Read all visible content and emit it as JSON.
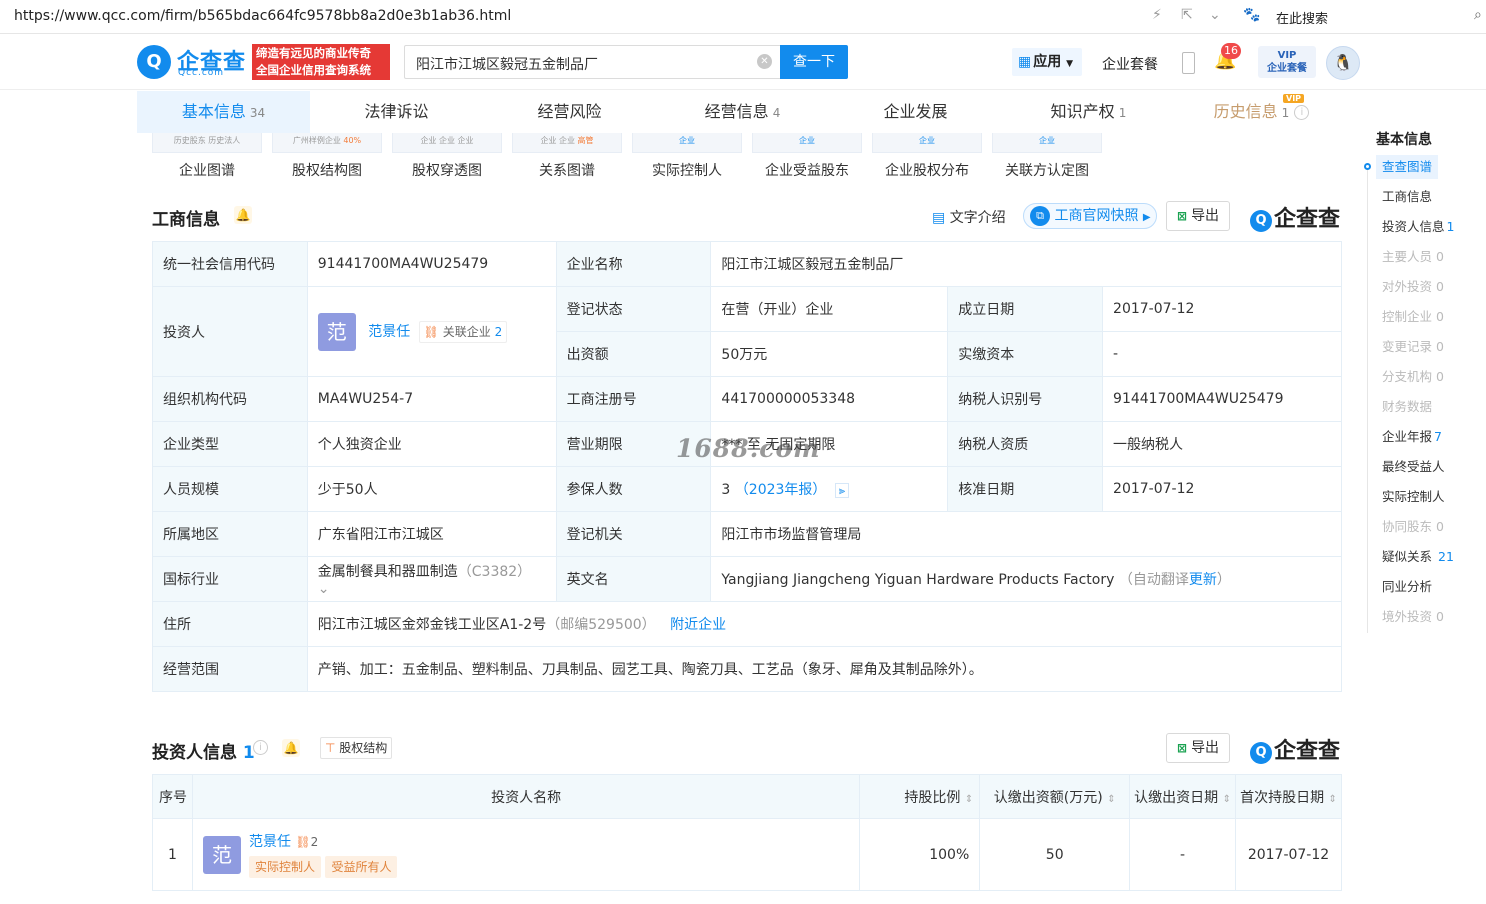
{
  "browser": {
    "url": "https://www.qcc.com/firm/b565bdac664fc9578bb8a2d0e3b1ab36.html",
    "search_placeholder": "在此搜索"
  },
  "header": {
    "logo_mark": "Q",
    "logo_text": "企查查",
    "logo_sub": "Qcc.com",
    "slogan_line1": "缔造有远见的商业传奇",
    "slogan_line2": "全国企业信用查询系统",
    "search_value": "阳江市江城区毅冠五金制品厂",
    "search_button": "查一下",
    "apps_label": "应用",
    "package_label": "企业套餐",
    "notification_count": "16",
    "vip_line1": "VIP",
    "vip_line2": "企业套餐"
  },
  "tabs": [
    {
      "label": "基本信息",
      "count": "34"
    },
    {
      "label": "法律诉讼",
      "count": ""
    },
    {
      "label": "经营风险",
      "count": ""
    },
    {
      "label": "经营信息",
      "count": "4"
    },
    {
      "label": "企业发展",
      "count": ""
    },
    {
      "label": "知识产权",
      "count": "1"
    },
    {
      "label": "历史信息",
      "count": "1",
      "badge": "VIP"
    }
  ],
  "graphs": [
    "企业图谱",
    "股权结构图",
    "股权穿透图",
    "关系图谱",
    "实际控制人",
    "企业受益股东",
    "企业股权分布",
    "关联方认定图"
  ],
  "thumb_texts": [
    "历史股东",
    "历史法人",
    "广州样例企业",
    "40%",
    "企业",
    "企业",
    "企业",
    "企业",
    "企业",
    "高管",
    "企业",
    "企业",
    "企业",
    "企业"
  ],
  "business": {
    "title": "工商信息",
    "text_intro": "文字介绍",
    "snapshot": "工商官网快照",
    "export": "导出",
    "brand": "企查查",
    "rows": {
      "credit_code_k": "统一社会信用代码",
      "credit_code_v": "91441700MA4WU25479",
      "name_k": "企业名称",
      "name_v": "阳江市江城区毅冠五金制品厂",
      "investor_k": "投资人",
      "investor_avatar": "范",
      "investor_v": "范景任",
      "related_k": "关联企业",
      "related_v": "2",
      "status_k": "登记状态",
      "status_v": "在营（开业）企业",
      "found_k": "成立日期",
      "found_v": "2017-07-12",
      "capital_k": "出资额",
      "capital_v": "50万元",
      "paid_k": "实缴资本",
      "paid_v": "-",
      "org_k": "组织机构代码",
      "org_v": "MA4WU254-7",
      "reg_k": "工商注册号",
      "reg_v": "441700000053348",
      "tax_k": "纳税人识别号",
      "tax_v": "91441700MA4WU25479",
      "type_k": "企业类型",
      "type_v": "个人独资企业",
      "term_k": "营业期限",
      "term_v": "*** 至 无固定期限",
      "taxq_k": "纳税人资质",
      "taxq_v": "一般纳税人",
      "size_k": "人员规模",
      "size_v": "少于50人",
      "ins_k": "参保人数",
      "ins_v": "3",
      "ins_year": "（2023年报）",
      "approve_k": "核准日期",
      "approve_v": "2017-07-12",
      "region_k": "所属地区",
      "region_v": "广东省阳江市江城区",
      "authority_k": "登记机关",
      "authority_v": "阳江市市场监督管理局",
      "industry_k": "国标行业",
      "industry_v": "金属制餐具和器皿制造",
      "industry_code": "（C3382）",
      "en_k": "英文名",
      "en_v": "Yangjiang Jiangcheng Yiguan Hardware Products Factory",
      "en_note_pre": "（自动翻译",
      "en_update": "更新",
      "en_note_post": "）",
      "addr_k": "住所",
      "addr_v": "阳江市江城区金郊金钱工业区A1-2号",
      "addr_zip": "（邮编529500）",
      "addr_near": "附近企业",
      "scope_k": "经营范围",
      "scope_v": "产销、加工：五金制品、塑料制品、刀具制品、园艺工具、陶瓷刀具、工艺品（象牙、犀角及其制品除外）。"
    }
  },
  "investors": {
    "title": "投资人信息",
    "count": "1",
    "equity_btn": "股权结构",
    "export": "导出",
    "brand": "企查查",
    "headers": [
      "序号",
      "投资人名称",
      "持股比例",
      "认缴出资额(万元)",
      "认缴出资日期",
      "首次持股日期"
    ],
    "rows": [
      {
        "idx": "1",
        "avatar": "范",
        "name": "范景任",
        "rel": "2",
        "tag1": "实际控制人",
        "tag2": "受益所有人",
        "ratio": "100%",
        "amount": "50",
        "date": "-",
        "first": "2017-07-12"
      }
    ]
  },
  "sidebar": {
    "title": "基本信息",
    "items": [
      {
        "label": "查查图谱",
        "count": ""
      },
      {
        "label": "工商信息",
        "count": ""
      },
      {
        "label": "投资人信息",
        "count": "1"
      },
      {
        "label": "主要人员",
        "count": "0"
      },
      {
        "label": "对外投资",
        "count": "0"
      },
      {
        "label": "控制企业",
        "count": "0"
      },
      {
        "label": "变更记录",
        "count": "0"
      },
      {
        "label": "分支机构",
        "count": "0"
      },
      {
        "label": "财务数据",
        "count": ""
      },
      {
        "label": "企业年报",
        "count": "7"
      },
      {
        "label": "最终受益人",
        "count": ""
      },
      {
        "label": "实际控制人",
        "count": ""
      },
      {
        "label": "协同股东",
        "count": "0"
      },
      {
        "label": "疑似关系",
        "count": "21"
      },
      {
        "label": "同业分析",
        "count": ""
      },
      {
        "label": "境外投资",
        "count": "0"
      }
    ]
  },
  "watermark": "1688.com"
}
